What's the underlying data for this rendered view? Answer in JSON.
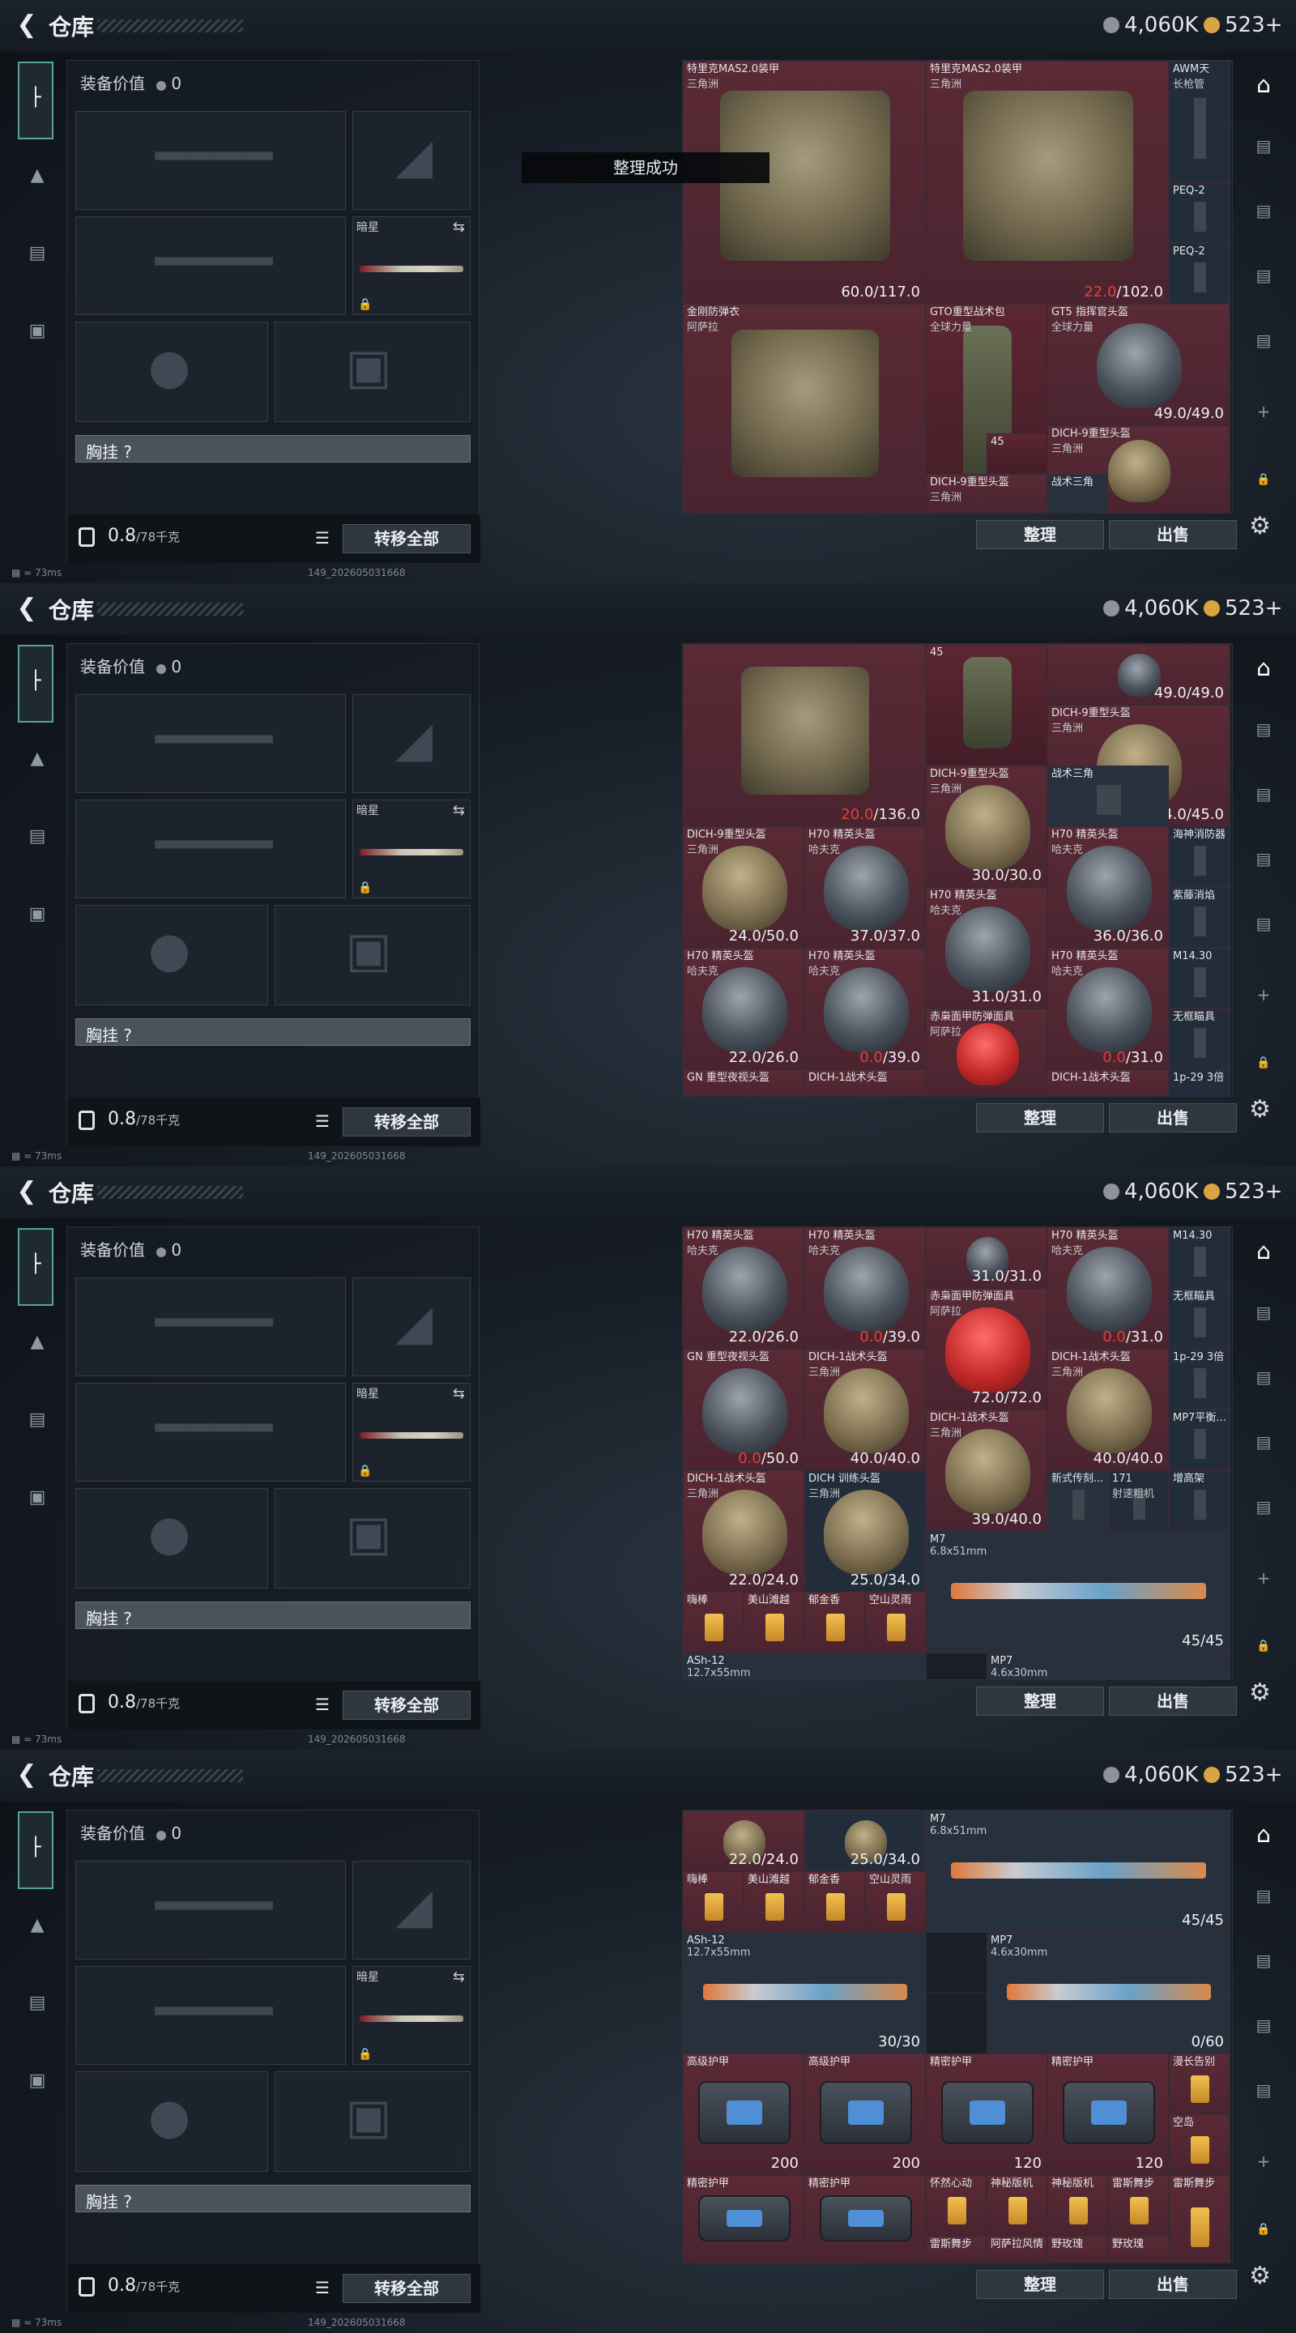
{
  "header": {
    "title": "仓库",
    "currency1": "4,060K",
    "currency2": "523+"
  },
  "left": {
    "value_label": "装备价值",
    "value": "0",
    "slot_label_star": "暗星",
    "chest_label": "胸挂 ?",
    "weight": "0.8",
    "weight_max": "/78千克",
    "transfer_all": "转移全部"
  },
  "right": {
    "sort": "整理",
    "sell": "出售"
  },
  "toast": "整理成功",
  "status": {
    "ping": "73ms",
    "build": "149_202605031668"
  },
  "colors": {
    "accent": "#5ba19c",
    "item_bg": "#4a2430",
    "low_durability": "#e0413a"
  },
  "frames": [
    {
      "cells": [
        {
          "name": "特里克MAS2.0装甲",
          "sub": "三角洲",
          "dur": "60.0/117.0"
        },
        {
          "name": "特里克MAS2.0装甲",
          "sub": "三角洲",
          "dur_low": "22.0",
          "dur": "/102.0"
        },
        {
          "name": "AWM天",
          "sub": "长枪管"
        },
        {
          "name": "PEQ-2"
        },
        {
          "name": "PEQ-2"
        },
        {
          "name": "金刚防弹衣",
          "sub": "阿萨拉"
        },
        {
          "name": "GTO重型战术包",
          "sub": "全球力量"
        },
        {
          "name": "GT5 指挥官头盔",
          "sub": "全球力量",
          "dur": "49.0/49.0"
        },
        {
          "name": "DICH-9重型头盔",
          "sub": "三角洲"
        },
        {
          "name": "DICH-9重型头盔",
          "sub": "三角洲"
        },
        {
          "name": "战术三角"
        },
        {
          "name": "45"
        }
      ]
    },
    {
      "cells": [
        {
          "dur": "49.0/49.0"
        },
        {
          "name": "DICH-9重型头盔",
          "sub": "三角洲",
          "dur": "34.0/45.0"
        },
        {
          "dur_low": "20.0",
          "dur": "/136.0"
        },
        {
          "name": "45"
        },
        {
          "name": "DICH-9重型头盔",
          "sub": "三角洲",
          "dur": "30.0/30.0"
        },
        {
          "name": "战术三角"
        },
        {
          "name": "DICH-9重型头盔",
          "sub": "三角洲",
          "dur": "24.0/50.0"
        },
        {
          "name": "H70 精英头盔",
          "sub": "哈夫克",
          "dur": "37.0/37.0"
        },
        {
          "name": "H70 精英头盔",
          "sub": "哈夫克",
          "dur": "36.0/36.0"
        },
        {
          "name": "海神消防器"
        },
        {
          "name": "H70 精英头盔",
          "sub": "哈夫克",
          "dur": "31.0/31.0"
        },
        {
          "name": "紫藤消焰"
        },
        {
          "name": "H70 精英头盔",
          "sub": "哈夫克",
          "dur": "22.0/26.0"
        },
        {
          "name": "H70 精英头盔",
          "sub": "哈夫克",
          "dur_low": "0.0",
          "dur": "/39.0"
        },
        {
          "name": "赤枭面甲防弹面具",
          "sub": "阿萨拉"
        },
        {
          "name": "H70 精英头盔",
          "sub": "哈夫克",
          "dur_low": "0.0",
          "dur": "/31.0"
        },
        {
          "name": "M14.30"
        },
        {
          "name": "无框瞄具"
        },
        {
          "name": "GN 重型夜视头盔"
        },
        {
          "name": "DICH-1战术头盔"
        },
        {
          "name": "DICH-1战术头盔"
        },
        {
          "name": "1p-29 3倍"
        }
      ]
    },
    {
      "cells": [
        {
          "name": "H70 精英头盔",
          "sub": "哈夫克",
          "dur": "22.0/26.0"
        },
        {
          "name": "H70 精英头盔",
          "sub": "哈夫克",
          "dur_low": "0.0",
          "dur": "/39.0"
        },
        {
          "dur": "31.0/31.0"
        },
        {
          "name": "H70 精英头盔",
          "sub": "哈夫克",
          "dur_low": "0.0",
          "dur": "/31.0"
        },
        {
          "name": "M14.30"
        },
        {
          "name": "赤枭面甲防弹面具",
          "sub": "阿萨拉",
          "dur": "72.0/72.0"
        },
        {
          "name": "无框瞄具"
        },
        {
          "name": "GN 重型夜视头盔",
          "sub": "",
          "dur_low": "0.0",
          "dur": "/50.0"
        },
        {
          "name": "DICH-1战术头盔",
          "sub": "三角洲",
          "dur": "40.0/40.0"
        },
        {
          "name": "DICH-1战术头盔",
          "sub": "三角洲",
          "dur": "40.0/40.0"
        },
        {
          "name": "1p-29 3倍"
        },
        {
          "name": "DICH-1战术头盔",
          "sub": "三角洲",
          "dur": "39.0/40.0"
        },
        {
          "name": "MP7平衡..."
        },
        {
          "name": "新式传刻..."
        },
        {
          "name": "171",
          "sub": "射速粗机"
        },
        {
          "name": "增高架"
        },
        {
          "name": "DICH-1战术头盔",
          "sub": "三角洲",
          "dur": "22.0/24.0"
        },
        {
          "name": "DICH 训练头盔",
          "sub": "三角洲",
          "dur": "25.0/34.0"
        },
        {
          "name": "M7",
          "sub": "6.8x51mm",
          "dur": "45/45"
        },
        {
          "name": "嗨棒"
        },
        {
          "name": "美山滩越"
        },
        {
          "name": "郁金香"
        },
        {
          "name": "空山灵雨"
        },
        {
          "name": "ASh-12",
          "sub": "12.7x55mm"
        },
        {
          "name": "MP7",
          "sub": "4.6x30mm"
        }
      ]
    },
    {
      "cells": [
        {
          "dur": "22.0/24.0"
        },
        {
          "dur": "25.0/34.0"
        },
        {
          "name": "M7",
          "sub": "6.8x51mm",
          "dur": "45/45"
        },
        {
          "name": "嗨棒"
        },
        {
          "name": "美山滩越"
        },
        {
          "name": "郁金香"
        },
        {
          "name": "空山灵雨"
        },
        {
          "name": "ASh-12",
          "sub": "12.7x55mm",
          "dur": "30/30"
        },
        {
          "name": "MP7",
          "sub": "4.6x30mm",
          "dur": "0/60"
        },
        {
          "name": "高级护甲",
          "dur": "200"
        },
        {
          "name": "高级护甲",
          "dur": "200"
        },
        {
          "name": "精密护甲",
          "dur": "120"
        },
        {
          "name": "精密护甲",
          "dur": "120"
        },
        {
          "name": "漫长告别"
        },
        {
          "name": "空岛"
        },
        {
          "name": "精密护甲"
        },
        {
          "name": "精密护甲"
        },
        {
          "name": "怀然心动"
        },
        {
          "name": "神秘版机"
        },
        {
          "name": "神秘版机"
        },
        {
          "name": "雷斯舞步"
        },
        {
          "name": "雷斯舞步"
        },
        {
          "name": "雷斯舞步"
        },
        {
          "name": "阿萨拉风情"
        },
        {
          "name": "野玫瑰"
        },
        {
          "name": "野玫瑰"
        }
      ]
    }
  ]
}
